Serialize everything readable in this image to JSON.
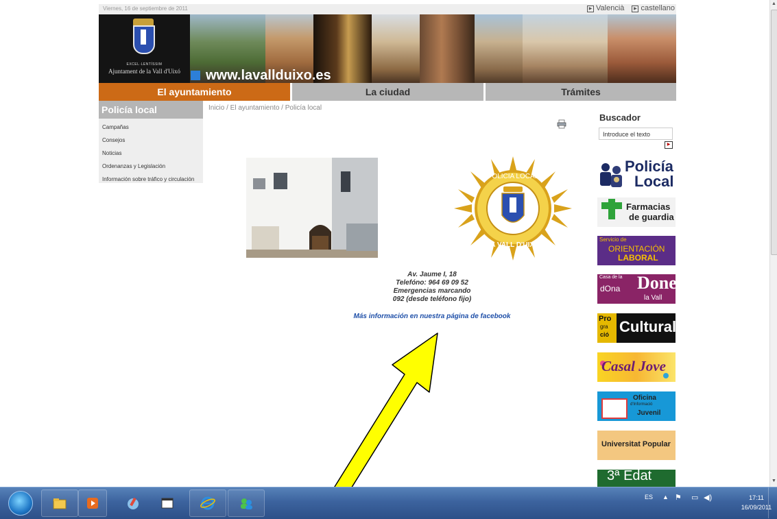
{
  "topbar": {
    "date": "Viernes, 16 de septiembre de 2011",
    "lang_valencian": "Valencià",
    "lang_castilian": "castellano"
  },
  "banner": {
    "crest_line1": "EXCEL·LENTÍSSIM",
    "crest_line2": "Ajuntament de la Vall d'Uixó",
    "url": "www.lavallduixo.es"
  },
  "nav": {
    "items": [
      {
        "label": "El ayuntamiento",
        "active": true
      },
      {
        "label": "La ciudad",
        "active": false
      },
      {
        "label": "Trámites",
        "active": false
      }
    ]
  },
  "sidebar": {
    "title": "Policía local",
    "items": [
      {
        "label": "Campañas"
      },
      {
        "label": "Consejos"
      },
      {
        "label": "Noticias"
      },
      {
        "label": "Ordenanzas y Legislación"
      },
      {
        "label": "Información sobre tráfico y circulación"
      }
    ]
  },
  "breadcrumb": "Inicio / El ayuntamiento / Policía local",
  "search": {
    "title": "Buscador",
    "placeholder": "Introduce el texto"
  },
  "badge": {
    "top_text": "POLICIA LOCAL",
    "bottom_text": "LA VALL D'UIXO"
  },
  "info": {
    "address": "Av. Jaume I, 18",
    "phone": "Telefóno: 964 69 09 52",
    "emergency1": "Emergencias marcando",
    "emergency2": "092 (desde teléfono fijo)",
    "facebook": "Más información en nuestra página de facebook"
  },
  "ads": [
    {
      "line1": "Policía",
      "line2": "Local"
    },
    {
      "line1": "Farmacias",
      "line2": "de guardia"
    },
    {
      "line1": "Servicio de",
      "line2": "ORIENTACIÓN",
      "line3": "LABORAL"
    },
    {
      "line1": "Casa de la",
      "line2": "dOna",
      "line3": "Dones",
      "line4": "la Vall"
    },
    {
      "line1": "Pro",
      "line2": "gra",
      "line3": "ció",
      "line4": "Cultural"
    },
    {
      "line1": "Casal Jove"
    },
    {
      "line1": "Oficina",
      "line2": "d'Informació",
      "line3": "Juvenil"
    },
    {
      "line1": "Universitat Popular"
    },
    {
      "line1": "3ª Edat"
    }
  ],
  "taskbar": {
    "lang": "ES",
    "time": "17:11",
    "date": "16/09/2011"
  },
  "colors": {
    "nav_active": "#cc6a16",
    "nav_inactive": "#b7b7b7",
    "link_blue": "#1e4fa8",
    "arrow_yellow": "#ffff00"
  }
}
